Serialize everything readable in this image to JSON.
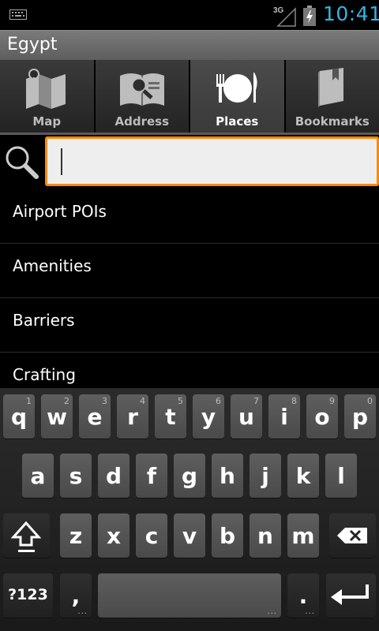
{
  "status_bar": {
    "network": "3G",
    "time": "10:41"
  },
  "title_bar": {
    "title": "Egypt"
  },
  "tabs": [
    {
      "label": "Map",
      "icon": "map-icon"
    },
    {
      "label": "Address",
      "icon": "address-book-icon"
    },
    {
      "label": "Places",
      "icon": "places-dining-icon",
      "active": true
    },
    {
      "label": "Bookmarks",
      "icon": "bookmark-icon"
    }
  ],
  "search": {
    "value": "",
    "placeholder": ""
  },
  "list": {
    "items": [
      "Airport POIs",
      "Amenities",
      "Barriers",
      "Crafting"
    ]
  },
  "keyboard": {
    "row1": [
      {
        "key": "q",
        "hint": "1"
      },
      {
        "key": "w",
        "hint": "2"
      },
      {
        "key": "e",
        "hint": "3"
      },
      {
        "key": "r",
        "hint": "4"
      },
      {
        "key": "t",
        "hint": "5"
      },
      {
        "key": "y",
        "hint": "6"
      },
      {
        "key": "u",
        "hint": "7"
      },
      {
        "key": "i",
        "hint": "8"
      },
      {
        "key": "o",
        "hint": "9"
      },
      {
        "key": "p",
        "hint": "0"
      }
    ],
    "row2": [
      "a",
      "s",
      "d",
      "f",
      "g",
      "h",
      "j",
      "k",
      "l"
    ],
    "row3": [
      "z",
      "x",
      "c",
      "v",
      "b",
      "n",
      "m"
    ],
    "symbols_label": "?123",
    "comma": ",",
    "period": ".",
    "accent_color": "#33b5e5",
    "highlight_color": "#ff8800"
  }
}
